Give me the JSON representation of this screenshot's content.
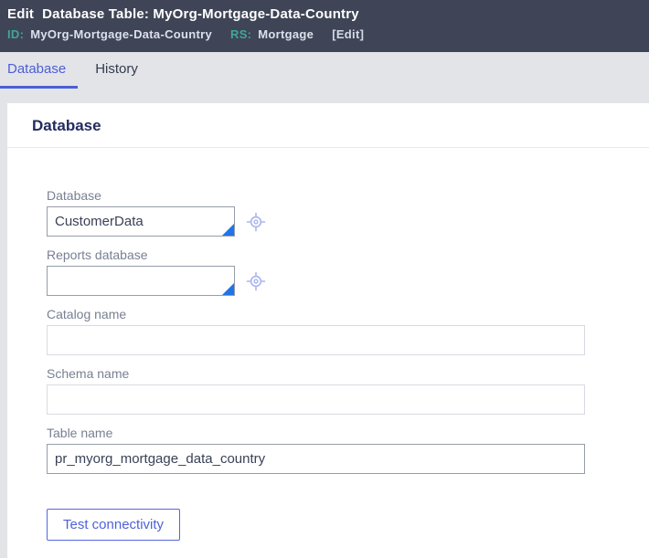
{
  "header": {
    "title_action": "Edit",
    "title": "Database Table: MyOrg-Mortgage-Data-Country",
    "id_label": "ID:",
    "id_value": "MyOrg-Mortgage-Data-Country",
    "rs_label": "RS:",
    "rs_value": "Mortgage",
    "edit_link": "[Edit]"
  },
  "tabs": [
    {
      "label": "Database",
      "active": true
    },
    {
      "label": "History",
      "active": false
    }
  ],
  "section": {
    "title": "Database"
  },
  "form": {
    "fields": [
      {
        "label": "Database",
        "value": "CustomerData"
      },
      {
        "label": "Reports database",
        "value": ""
      },
      {
        "label": "Catalog name",
        "value": ""
      },
      {
        "label": "Schema name",
        "value": ""
      },
      {
        "label": "Table name",
        "value": "pr_myorg_mortgage_data_country"
      }
    ],
    "test_button_label": "Test connectivity"
  },
  "icons": {
    "target": "crosshair-target-icon",
    "autocomplete_corner": "autocomplete-corner-icon"
  },
  "colors": {
    "header_bg": "#3F4456",
    "header_teal": "#3FA796",
    "accent_indigo": "#4C5ED6",
    "autocomplete_blue": "#2173E8",
    "target_icon": "#AAB3EF",
    "section_title": "#232C5F",
    "page_bg": "#E3E4E8"
  }
}
